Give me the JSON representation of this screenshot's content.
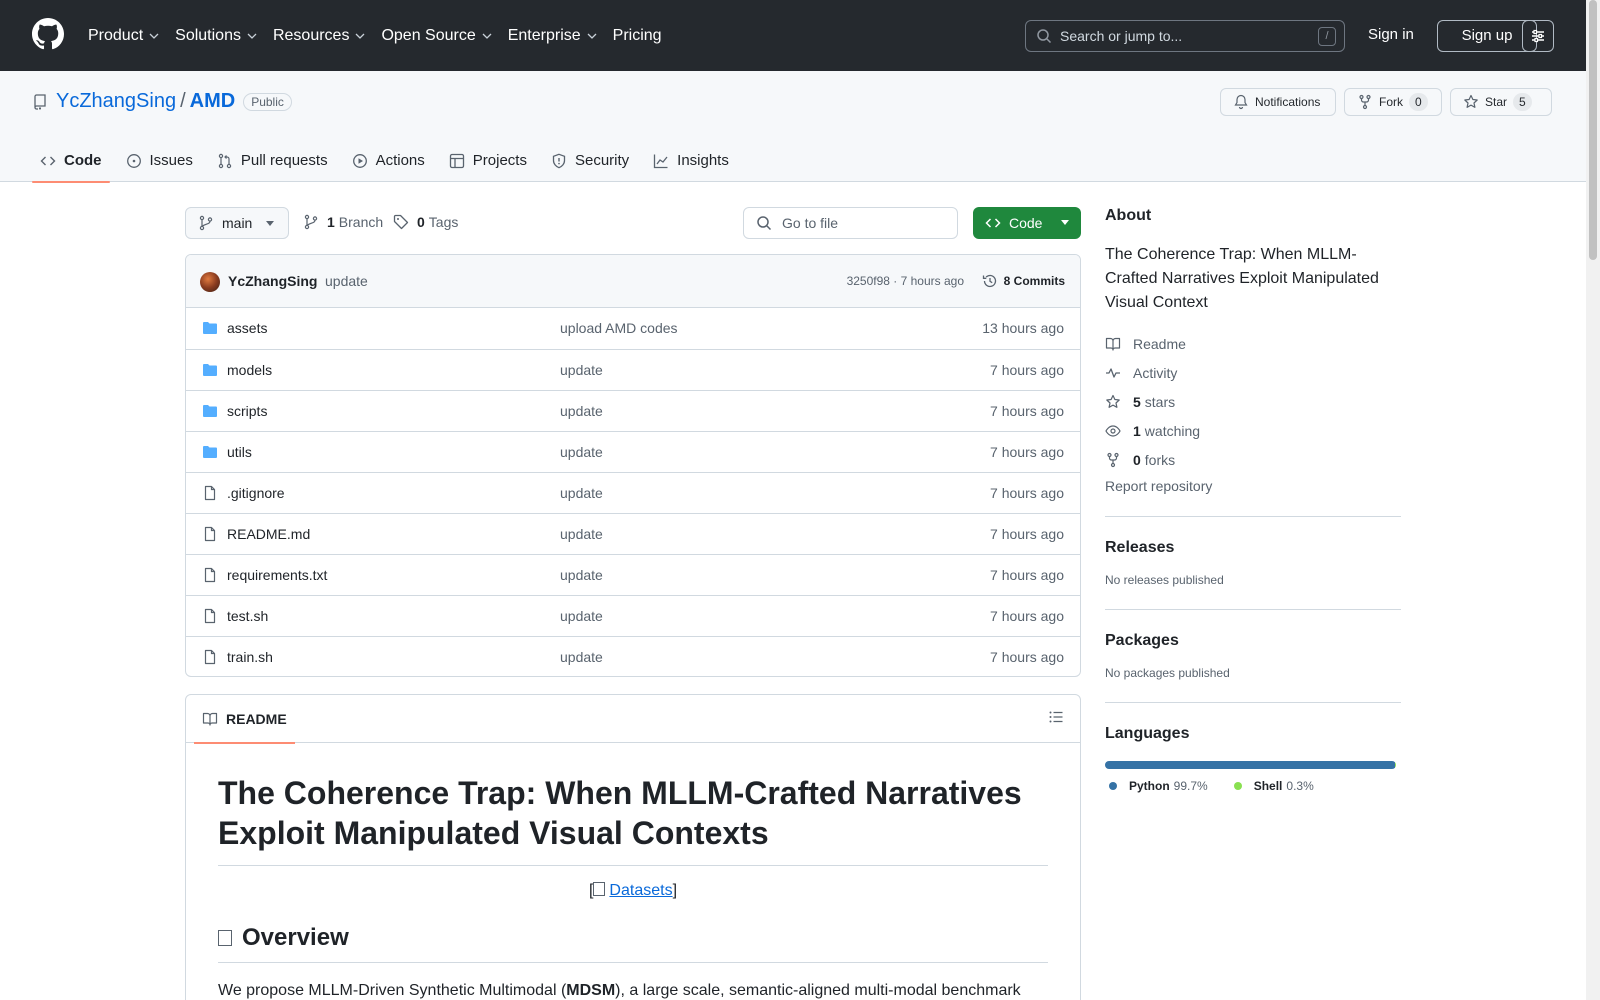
{
  "header": {
    "nav": [
      "Product",
      "Solutions",
      "Resources",
      "Open Source",
      "Enterprise",
      "Pricing"
    ],
    "nav_has_menu": [
      true,
      true,
      true,
      true,
      true,
      false
    ],
    "search_placeholder": "Search or jump to...",
    "search_shortcut": "/",
    "sign_in": "Sign in",
    "sign_up": "Sign up"
  },
  "repo": {
    "owner": "YcZhangSing",
    "separator": "/",
    "name": "AMD",
    "visibility": "Public",
    "notifications_label": "Notifications",
    "fork_label": "Fork",
    "fork_count": "0",
    "star_label": "Star",
    "star_count": "5",
    "tabs": [
      "Code",
      "Issues",
      "Pull requests",
      "Actions",
      "Projects",
      "Security",
      "Insights"
    ]
  },
  "branchbar": {
    "branch": "main",
    "branch_count": "1",
    "branch_label": "Branch",
    "tag_count": "0",
    "tag_label": "Tags",
    "goto_placeholder": "Go to file",
    "code_label": "Code"
  },
  "commit": {
    "author": "YcZhangSing",
    "message": "update",
    "meta": "3250f98 · 7 hours ago",
    "count_label": "8 Commits"
  },
  "files": [
    {
      "name": "assets",
      "type": "dir",
      "message": "upload AMD codes",
      "time": "13 hours ago"
    },
    {
      "name": "models",
      "type": "dir",
      "message": "update",
      "time": "7 hours ago"
    },
    {
      "name": "scripts",
      "type": "dir",
      "message": "update",
      "time": "7 hours ago"
    },
    {
      "name": "utils",
      "type": "dir",
      "message": "update",
      "time": "7 hours ago"
    },
    {
      "name": ".gitignore",
      "type": "file",
      "message": "update",
      "time": "7 hours ago"
    },
    {
      "name": "README.md",
      "type": "file",
      "message": "update",
      "time": "7 hours ago"
    },
    {
      "name": "requirements.txt",
      "type": "file",
      "message": "update",
      "time": "7 hours ago"
    },
    {
      "name": "test.sh",
      "type": "file",
      "message": "update",
      "time": "7 hours ago"
    },
    {
      "name": "train.sh",
      "type": "file",
      "message": "update",
      "time": "7 hours ago"
    }
  ],
  "readme": {
    "tab_label": "README",
    "title": "The Coherence Trap: When MLLM-Crafted Narratives Exploit Manipulated Visual Contexts",
    "datasets_open": "[",
    "datasets_link": "Datasets",
    "datasets_close": "]",
    "overview_heading": "Overview",
    "overview_pre": "We propose MLLM-Driven Synthetic Multimodal (",
    "overview_bold": "MDSM",
    "overview_post": "), a large scale, semantic-aligned multi-modal benchmark"
  },
  "sidebar": {
    "about_heading": "About",
    "about_desc": "The Coherence Trap: When MLLM-Crafted Narratives Exploit Manipulated Visual Context",
    "readme": "Readme",
    "activity": "Activity",
    "stars_count": "5",
    "stars_label": "stars",
    "watching_count": "1",
    "watching_label": "watching",
    "forks_count": "0",
    "forks_label": "forks",
    "report": "Report repository",
    "releases_heading": "Releases",
    "releases_text": "No releases published",
    "packages_heading": "Packages",
    "packages_text": "No packages published",
    "languages_heading": "Languages",
    "languages": [
      {
        "name": "Python",
        "percent": "99.7%",
        "value": 99.7,
        "color": "#3572A5"
      },
      {
        "name": "Shell",
        "percent": "0.3%",
        "value": 0.3,
        "color": "#89e051"
      }
    ]
  },
  "colors": {
    "header_bg": "#25292e",
    "link": "#0969da",
    "primary_button": "#1f883d",
    "active_tab_underline": "#fd8c73",
    "folder_icon": "#54aeff"
  }
}
